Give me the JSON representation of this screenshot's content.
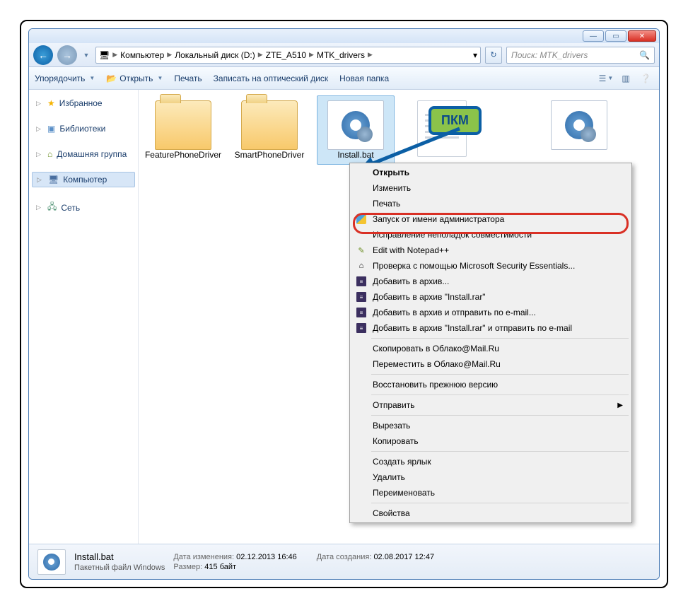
{
  "window_controls": {
    "min": "—",
    "max": "▭",
    "close": "✕"
  },
  "nav": {
    "back": "←",
    "fwd": "→"
  },
  "breadcrumb": {
    "icon": "🖥",
    "items": [
      "Компьютер",
      "Локальный диск (D:)",
      "ZTE_A510",
      "MTK_drivers"
    ]
  },
  "address_dropdown": "▾",
  "refresh": "↻",
  "search": {
    "placeholder": "Поиск: MTK_drivers",
    "icon": "🔍"
  },
  "toolbar": {
    "organize": "Упорядочить",
    "open": "Открыть",
    "open_icon": "📂",
    "print": "Печать",
    "burn": "Записать на оптический диск",
    "new_folder": "Новая папка",
    "view_icon": "☰",
    "help_icon": "❔"
  },
  "sidebar": {
    "favorites": "Избранное",
    "libraries": "Библиотеки",
    "homegroup": "Домашняя группа",
    "computer": "Компьютер",
    "network": "Сеть"
  },
  "files": {
    "f1": "FeaturePhoneDriver",
    "f2": "SmartPhoneDriver",
    "f3": "Install.bat"
  },
  "callout": "ПКМ",
  "context_menu": {
    "open": "Открыть",
    "edit": "Изменить",
    "print": "Печать",
    "run_as_admin": "Запуск от имени администратора",
    "compat": "Исправление неполадок совместимости",
    "notepadpp": "Edit with Notepad++",
    "mse": "Проверка с помощью Microsoft Security Essentials...",
    "rar1": "Добавить в архив...",
    "rar2": "Добавить в архив \"Install.rar\"",
    "rar3": "Добавить в архив и отправить по e-mail...",
    "rar4": "Добавить в архив \"Install.rar\" и отправить по e-mail",
    "cloud_copy": "Скопировать в Облако@Mail.Ru",
    "cloud_move": "Переместить в Облако@Mail.Ru",
    "restore": "Восстановить прежнюю версию",
    "send_to": "Отправить",
    "cut": "Вырезать",
    "copy": "Копировать",
    "shortcut": "Создать ярлык",
    "delete": "Удалить",
    "rename": "Переименовать",
    "properties": "Свойства"
  },
  "status": {
    "filename": "Install.bat",
    "filetype": "Пакетный файл Windows",
    "modified_lbl": "Дата изменения:",
    "modified_val": "02.12.2013 16:46",
    "size_lbl": "Размер:",
    "size_val": "415 байт",
    "created_lbl": "Дата создания:",
    "created_val": "02.08.2017 12:47"
  }
}
